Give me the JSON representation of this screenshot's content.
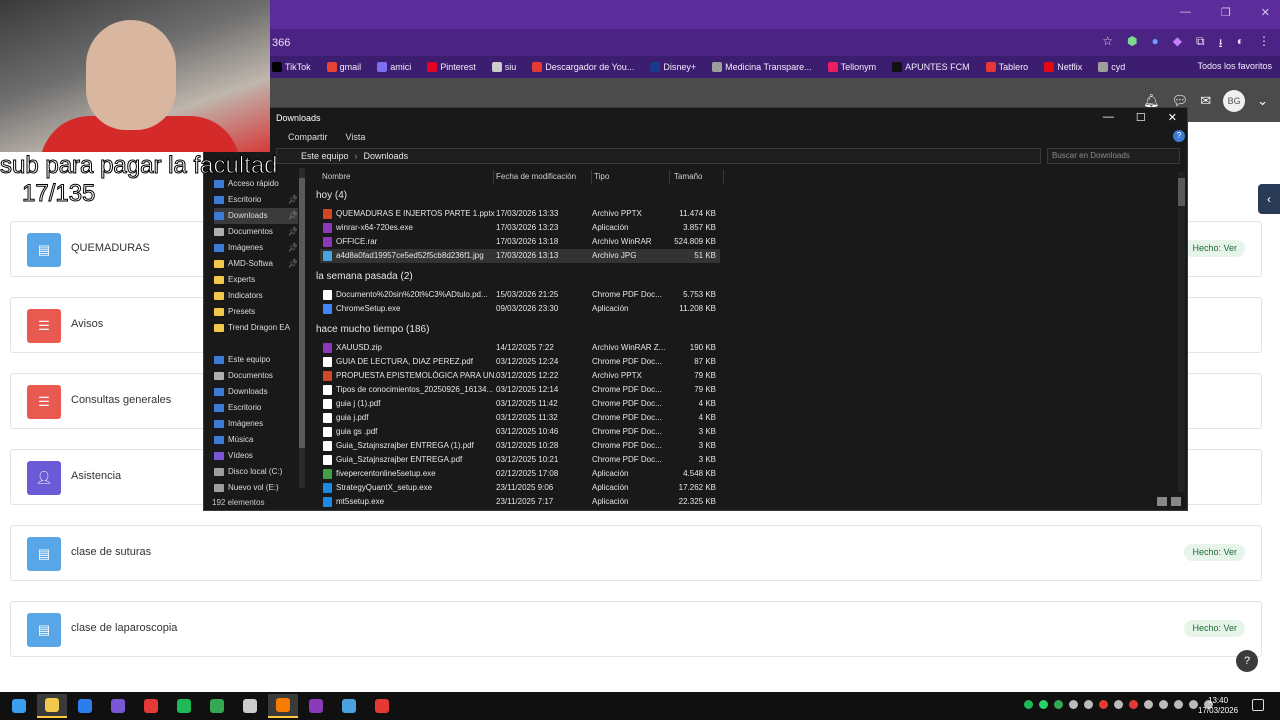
{
  "browser": {
    "url": "366",
    "bookmarks": [
      {
        "label": "TikTok",
        "icon": "tiktok-icon",
        "color": "#000000"
      },
      {
        "label": "gmail",
        "icon": "gmail-icon",
        "color": "#ea4335"
      },
      {
        "label": "amici",
        "icon": "amici-icon",
        "color": "#7d6df0"
      },
      {
        "label": "Pinterest",
        "icon": "pinterest-icon",
        "color": "#e60023"
      },
      {
        "label": "siu",
        "icon": "globe-icon",
        "color": "#cccccc"
      },
      {
        "label": "Descargador de You...",
        "icon": "download-icon",
        "color": "#e53935"
      },
      {
        "label": "Disney+",
        "icon": "disney-icon",
        "color": "#1a3a8a"
      },
      {
        "label": "Medicina Transpare...",
        "icon": "page-icon",
        "color": "#9e9e9e"
      },
      {
        "label": "Tellonym",
        "icon": "tellonym-icon",
        "color": "#e91e63"
      },
      {
        "label": "APUNTES FCM",
        "icon": "w-icon",
        "color": "#111111"
      },
      {
        "label": "Tablero",
        "icon": "tablero-icon",
        "color": "#e53935"
      },
      {
        "label": "Netflix",
        "icon": "netflix-icon",
        "color": "#e50914"
      },
      {
        "label": "cyd",
        "icon": "cyd-icon",
        "color": "#9e9e9e"
      }
    ],
    "all_bookmarks": "Todos los favoritos"
  },
  "page": {
    "avatar": "BG",
    "cards": [
      {
        "label": "QUEMADURAS",
        "color": "blue",
        "status": "Hecho: Ver"
      },
      {
        "label": "Avisos",
        "color": "red",
        "status": ""
      },
      {
        "label": "Consultas generales",
        "color": "red",
        "status": ""
      },
      {
        "label": "Asistencia",
        "color": "purple",
        "status": ""
      },
      {
        "label": "clase de suturas",
        "color": "blue",
        "status": "Hecho: Ver"
      },
      {
        "label": "clase de laparoscopia",
        "color": "blue",
        "status": "Hecho: Ver"
      }
    ],
    "help": "?"
  },
  "overlay": {
    "caption_line1": "sub para pagar la facultad",
    "caption_line2": "17/135"
  },
  "explorer": {
    "title": "Downloads",
    "ribbon": [
      "Compartir",
      "Vista"
    ],
    "path": [
      "Este equipo",
      "Downloads"
    ],
    "search_placeholder": "Buscar en Downloads",
    "nav": [
      {
        "label": "Acceso rápido",
        "color": "#3c7bd6"
      },
      {
        "label": "Escritorio",
        "color": "#3c7bd6",
        "pin": true
      },
      {
        "label": "Downloads",
        "color": "#3c7bd6",
        "pin": true,
        "active": true
      },
      {
        "label": "Documentos",
        "color": "#b0b0b0",
        "pin": true
      },
      {
        "label": "Imágenes",
        "color": "#3c7bd6",
        "pin": true
      },
      {
        "label": "AMD-Softwa",
        "color": "#f2c94c",
        "pin": true
      },
      {
        "label": "Experts",
        "color": "#f2c94c"
      },
      {
        "label": "Indicators",
        "color": "#f2c94c"
      },
      {
        "label": "Presets",
        "color": "#f2c94c"
      },
      {
        "label": "Trend Dragon EA",
        "color": "#f2c94c"
      },
      {
        "label": "",
        "color": ""
      },
      {
        "label": "Este equipo",
        "color": "#3c7bd6"
      },
      {
        "label": "Documentos",
        "color": "#b0b0b0"
      },
      {
        "label": "Downloads",
        "color": "#3c7bd6"
      },
      {
        "label": "Escritorio",
        "color": "#3c7bd6"
      },
      {
        "label": "Imágenes",
        "color": "#3c7bd6"
      },
      {
        "label": "Música",
        "color": "#3c7bd6"
      },
      {
        "label": "Vídeos",
        "color": "#7b57d6"
      },
      {
        "label": "Disco local (C:)",
        "color": "#9e9e9e"
      },
      {
        "label": "Nuevo vol (E:)",
        "color": "#9e9e9e"
      }
    ],
    "columns": {
      "name": "Nombre",
      "date": "Fecha de modificación",
      "type": "Tipo",
      "size": "Tamaño"
    },
    "groups": [
      {
        "label": "hoy (4)",
        "files": [
          {
            "name": "QUEMADURAS E INJERTOS PARTE 1.pptx",
            "date": "17/03/2026 13:33",
            "type": "Archivo PPTX",
            "size": "11.474 KB",
            "color": "#d24726"
          },
          {
            "name": "winrar-x64-720es.exe",
            "date": "17/03/2026 13:23",
            "type": "Aplicación",
            "size": "3.857 KB",
            "color": "#8a3ab9"
          },
          {
            "name": "OFFICE.rar",
            "date": "17/03/2026 13:18",
            "type": "Archivo WinRAR",
            "size": "524.809 KB",
            "color": "#8a3ab9"
          },
          {
            "name": "a4d8a0fad19957ce5ed52f5cb8d236f1.jpg",
            "date": "17/03/2026 13:13",
            "type": "Archivo JPG",
            "size": "51 KB",
            "color": "#4aa3df",
            "selected": true
          }
        ]
      },
      {
        "label": "la semana pasada (2)",
        "files": [
          {
            "name": "Documento%20sin%20t%C3%ADtulo.pd...",
            "date": "15/03/2026 21:25",
            "type": "Chrome PDF Doc...",
            "size": "5.753 KB",
            "color": "#ffffff"
          },
          {
            "name": "ChromeSetup.exe",
            "date": "09/03/2026 23:30",
            "type": "Aplicación",
            "size": "11.208 KB",
            "color": "#4285f4"
          }
        ]
      },
      {
        "label": "hace mucho tiempo (186)",
        "files": [
          {
            "name": "XAUUSD.zip",
            "date": "14/12/2025 7:22",
            "type": "Archivo WinRAR Z...",
            "size": "190 KB",
            "color": "#8a3ab9"
          },
          {
            "name": "GUIA DE LECTURA, DIAZ PEREZ.pdf",
            "date": "03/12/2025 12:24",
            "type": "Chrome PDF Doc...",
            "size": "87 KB",
            "color": "#ffffff"
          },
          {
            "name": "PROPUESTA EPISTEMOLÓGICA PARA UN...",
            "date": "03/12/2025 12:22",
            "type": "Archivo PPTX",
            "size": "79 KB",
            "color": "#d24726"
          },
          {
            "name": "Tipos de conocimientos_20250926_16134...",
            "date": "03/12/2025 12:14",
            "type": "Chrome PDF Doc...",
            "size": "79 KB",
            "color": "#ffffff"
          },
          {
            "name": "guia j (1).pdf",
            "date": "03/12/2025 11:42",
            "type": "Chrome PDF Doc...",
            "size": "4 KB",
            "color": "#ffffff"
          },
          {
            "name": "guia j.pdf",
            "date": "03/12/2025 11:32",
            "type": "Chrome PDF Doc...",
            "size": "4 KB",
            "color": "#ffffff"
          },
          {
            "name": "guia gs .pdf",
            "date": "03/12/2025 10:46",
            "type": "Chrome PDF Doc...",
            "size": "3 KB",
            "color": "#ffffff"
          },
          {
            "name": "Guia_Sztajnszrajber ENTREGA (1).pdf",
            "date": "03/12/2025 10:28",
            "type": "Chrome PDF Doc...",
            "size": "3 KB",
            "color": "#ffffff"
          },
          {
            "name": "Guia_Sztajnszrajber ENTREGA.pdf",
            "date": "03/12/2025 10:21",
            "type": "Chrome PDF Doc...",
            "size": "3 KB",
            "color": "#ffffff"
          },
          {
            "name": "fivepercentonline5setup.exe",
            "date": "02/12/2025 17:08",
            "type": "Aplicación",
            "size": "4.548 KB",
            "color": "#43a047"
          },
          {
            "name": "StrategyQuantX_setup.exe",
            "date": "23/11/2025 9:06",
            "type": "Aplicación",
            "size": "17.262 KB",
            "color": "#1e88e5"
          },
          {
            "name": "mt5setup.exe",
            "date": "23/11/2025 7:17",
            "type": "Aplicación",
            "size": "22.325 KB",
            "color": "#1e88e5"
          }
        ]
      }
    ],
    "status": "192 elementos"
  },
  "taskbar": {
    "time": "13:40",
    "date": "17/03/2026",
    "apps": [
      {
        "icon": "windows-icon",
        "color": "#3c9ef0"
      },
      {
        "icon": "file-explorer-icon",
        "color": "#f2c94c",
        "active": true
      },
      {
        "icon": "store-icon",
        "color": "#2b7de9"
      },
      {
        "icon": "chrome-purple-icon",
        "color": "#7b57d6"
      },
      {
        "icon": "app-red-icon",
        "color": "#e53935"
      },
      {
        "icon": "spotify-icon",
        "color": "#1db954"
      },
      {
        "icon": "chrome-icon",
        "color": "#34a853"
      },
      {
        "icon": "obs-icon",
        "color": "#cccccc"
      },
      {
        "icon": "app-orange-icon",
        "color": "#f57c00",
        "active": true
      },
      {
        "icon": "winrar-icon",
        "color": "#8a3ab9"
      },
      {
        "icon": "photo-icon",
        "color": "#4aa3df"
      },
      {
        "icon": "pdf-icon",
        "color": "#e53935"
      }
    ]
  }
}
